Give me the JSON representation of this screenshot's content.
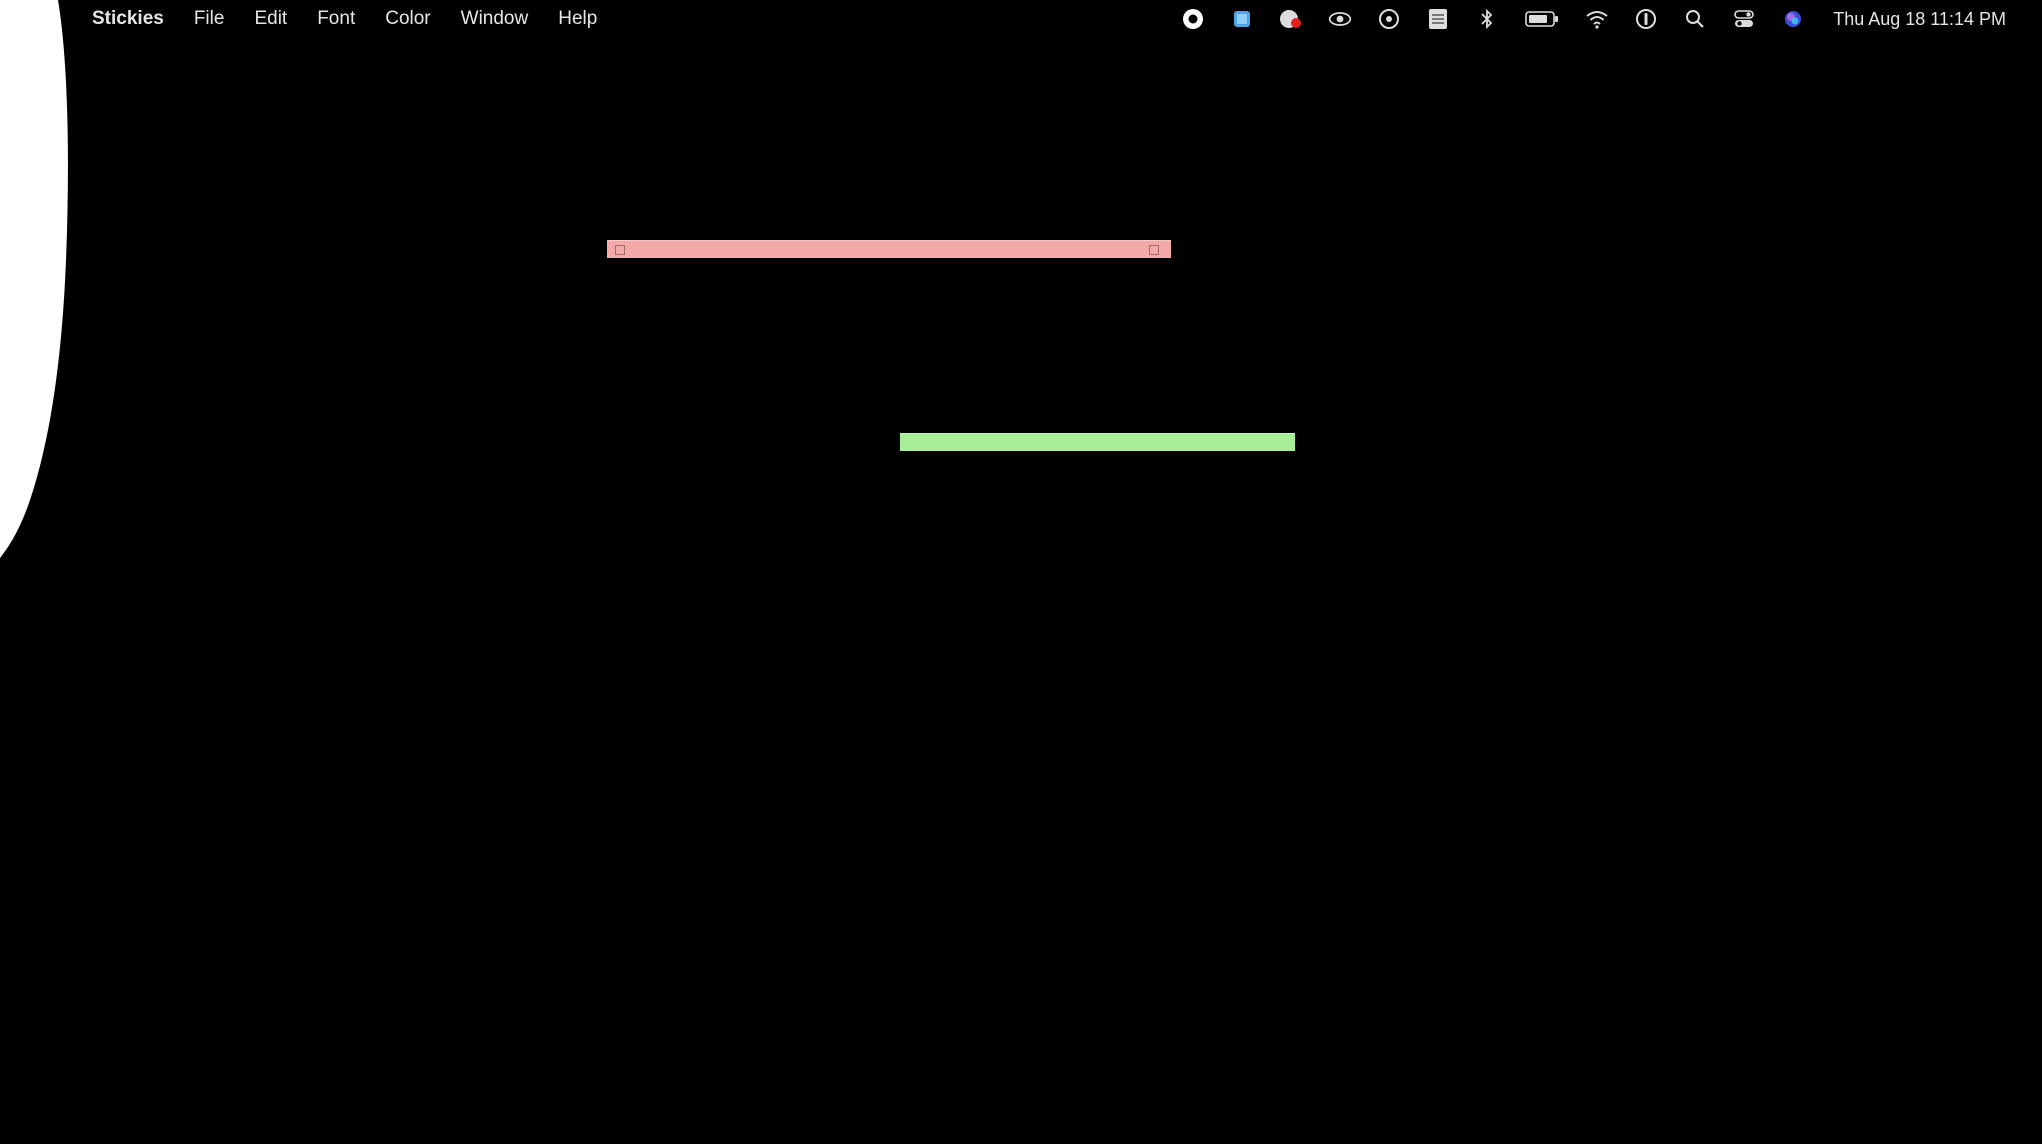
{
  "menubar": {
    "app_name": "Stickies",
    "items": [
      "File",
      "Edit",
      "Font",
      "Color",
      "Window",
      "Help"
    ],
    "status_icons": [
      "record-icon",
      "blue-square-app-icon",
      "notification-app-icon",
      "eye-icon",
      "circle-dot-icon",
      "calendar-icon",
      "bluetooth-icon",
      "battery-icon",
      "wifi-icon",
      "password-manager-icon",
      "search-icon",
      "control-center-icon",
      "siri-icon"
    ],
    "clock": "Thu Aug 18  11:14 PM"
  },
  "stickies": [
    {
      "color_name": "pink",
      "color": "#f4a8a8"
    },
    {
      "color_name": "green",
      "color": "#a8ee96"
    }
  ],
  "colors": {
    "desktop": "#000000",
    "menu_text": "#e6e6e6"
  }
}
